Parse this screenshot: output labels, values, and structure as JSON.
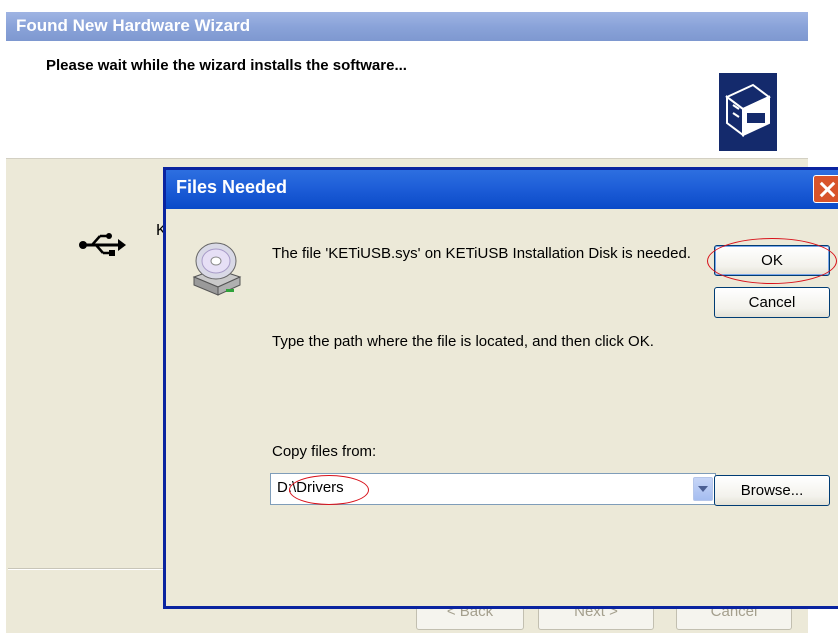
{
  "wizard": {
    "title": "Found New Hardware Wizard",
    "heading": "Please wait while the wizard installs the software...",
    "device_name_partial": "K",
    "buttons": {
      "back": "< Back",
      "next": "Next >",
      "cancel": "Cancel"
    }
  },
  "dialog": {
    "title": "Files Needed",
    "message_needed": "The file 'KETiUSB.sys' on KETiUSB Installation Disk is needed.",
    "message_instruction": "Type the path where the file is located, and then click OK.",
    "copy_from_label": "Copy files from:",
    "copy_from_value": "D:\\Drivers",
    "buttons": {
      "ok": "OK",
      "cancel": "Cancel",
      "browse": "Browse..."
    }
  },
  "icons": {
    "usb": "usb-icon",
    "disk": "cd-drive-icon",
    "wizard_logo": "hardware-box-icon",
    "close": "close-icon",
    "dropdown": "chevron-down-icon"
  },
  "colors": {
    "dialog_titlebar": "#1e5ed8",
    "wizard_titlebar_inactive": "#8aa3d9",
    "annotation": "#d8121b",
    "dialog_face": "#ece9d8"
  }
}
